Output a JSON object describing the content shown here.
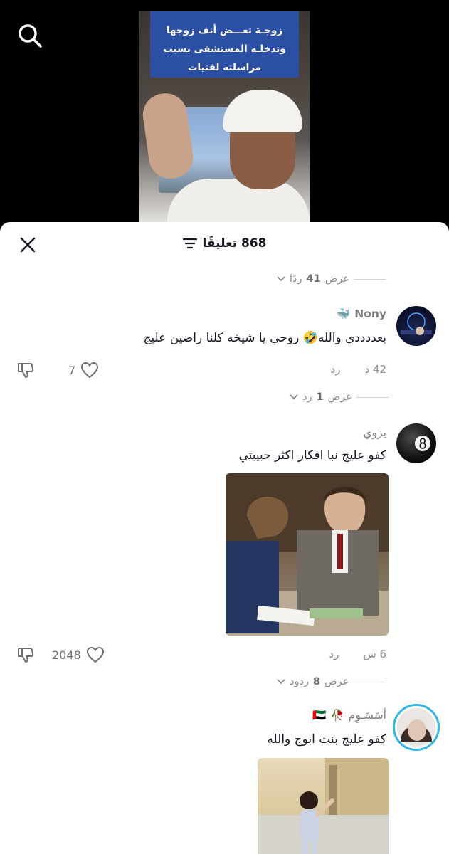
{
  "video": {
    "caption": "زوجـة تعـــض أنف زوجها وتدخلـه المستشفى بسبب مراسلته لفتيات"
  },
  "header": {
    "title": "868 تعليقًا"
  },
  "icons": {
    "search": "search-icon",
    "close": "close-icon",
    "filter": "filter-icon",
    "heart": "heart-icon",
    "dislike": "dislike-icon",
    "chevron": "chevron-down-icon",
    "flag": "uae-flag-icon",
    "rose": "rose-icon"
  },
  "top_thread": {
    "view_replies": "عرض",
    "count": "41",
    "unit": "ردًا"
  },
  "comments": [
    {
      "username": "Nony",
      "badge": "🐳",
      "text": "بعددددي والله🤣 روحي يا شيخه كلنا راضين عليج",
      "time": "42 د",
      "reply": "رد",
      "likes": "7",
      "view_replies": "عرض",
      "replies_count": "1",
      "replies_unit": "رد"
    },
    {
      "username": "يزوي",
      "text": "كفو عليج نبا افكار اكثر حبيبتي",
      "time": "6 س",
      "reply": "رد",
      "likes": "2048",
      "view_replies": "عرض",
      "replies_count": "8",
      "replies_unit": "ردود"
    },
    {
      "username": "أسًسًـوِم",
      "badge_flag": "🇦🇪",
      "badge_rose": "🥀",
      "text": "كفو عليج بنت ابوج والله"
    }
  ],
  "colors": {
    "caption_bg": "#2b4fa3",
    "text_primary": "#161823",
    "text_secondary": "#8a8b91"
  }
}
